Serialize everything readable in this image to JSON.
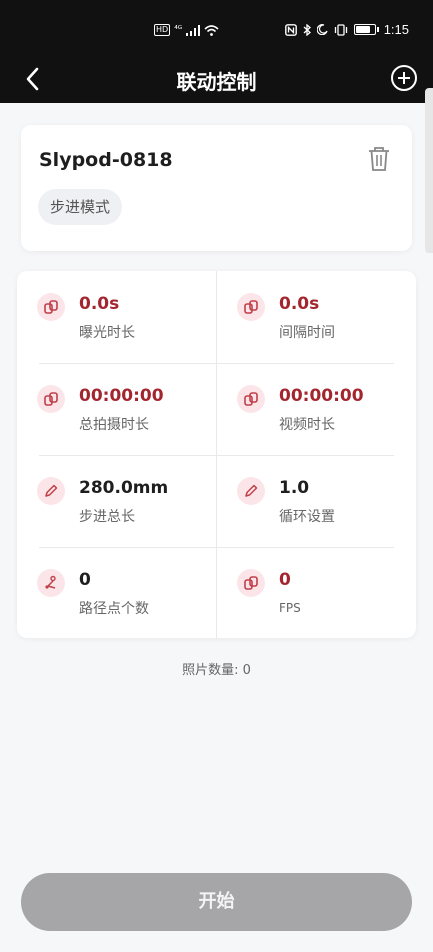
{
  "status_bar": {
    "left_icons": [
      "hd-icon",
      "4g-icon",
      "signal-icon",
      "wifi-icon"
    ],
    "left_text": "HD ⁴ᴳ",
    "right_icons": [
      "nfc-icon",
      "bluetooth-icon",
      "moon-icon",
      "vibrate-icon",
      "battery-icon"
    ],
    "time": "1:15",
    "battery_level": 0.85
  },
  "navbar": {
    "title": "联动控制",
    "back_icon": "chevron-left-icon",
    "add_icon": "plus-circle-icon"
  },
  "device": {
    "name": "Slypod-0818",
    "mode": "步进模式",
    "delete_icon": "trash-icon"
  },
  "params": [
    {
      "value": "0.0s",
      "label": "曝光时长",
      "icon": "link-icon",
      "color": "red"
    },
    {
      "value": "0.0s",
      "label": "间隔时间",
      "icon": "link-icon",
      "color": "red"
    },
    {
      "value": "00:00:00",
      "label": "总拍摄时长",
      "icon": "link-icon",
      "color": "red"
    },
    {
      "value": "00:00:00",
      "label": "视频时长",
      "icon": "link-icon",
      "color": "red"
    },
    {
      "value": "280.0mm",
      "label": "步进总长",
      "icon": "pencil-icon",
      "color": "dark"
    },
    {
      "value": "1.0",
      "label": "循环设置",
      "icon": "pencil-icon",
      "color": "dark"
    },
    {
      "value": "0",
      "label": "路径点个数",
      "icon": "route-icon",
      "color": "red"
    },
    {
      "value": "0",
      "label": "FPS",
      "icon": "link-icon",
      "color": "red"
    }
  ],
  "photo_count": "照片数量: 0",
  "start_button": "开始",
  "colors": {
    "accent_red": "#a3262f",
    "icon_bg": "#fbe5e8",
    "disabled_button": "#a6a6a8",
    "header_bg": "#111111"
  }
}
